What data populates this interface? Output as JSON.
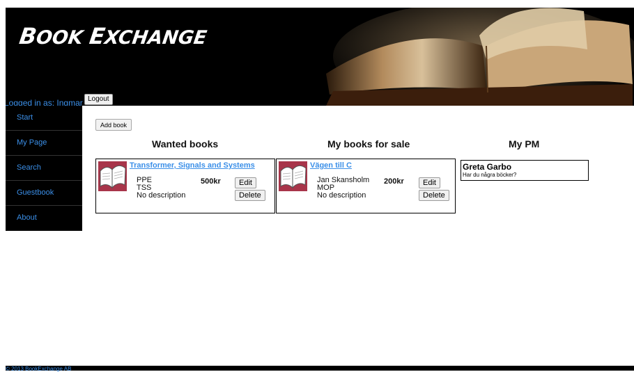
{
  "header": {
    "logo_part1_cap": "B",
    "logo_part1_rest": "OOK",
    "logo_part2_cap": "E",
    "logo_part2_rest": "XCHANGE",
    "logged_in_text": "Logged in as: Ingmar",
    "logout_label": "Logout"
  },
  "sidebar": {
    "items": [
      {
        "label": "Start"
      },
      {
        "label": "My Page"
      },
      {
        "label": "Search"
      },
      {
        "label": "Guestbook"
      },
      {
        "label": "About"
      }
    ]
  },
  "main": {
    "add_book_label": "Add book",
    "columns": {
      "wanted": "Wanted books",
      "for_sale": "My books for sale",
      "pm": "My PM"
    },
    "wanted_books": [
      {
        "title": "Transformer, Signals and Systems",
        "author": "PPE",
        "course": "TSS",
        "description": "No description",
        "price": "500kr",
        "edit_label": "Edit",
        "delete_label": "Delete"
      }
    ],
    "books_for_sale": [
      {
        "title": "Vägen till C",
        "author": "Jan Skansholm",
        "course": "MOP",
        "description": "No description",
        "price": "200kr",
        "edit_label": "Edit",
        "delete_label": "Delete"
      }
    ],
    "pm": [
      {
        "from": "Greta Garbo",
        "message": "Har du några böcker?"
      }
    ]
  },
  "footer": {
    "copyright": "© 2013 BookExchange AB"
  }
}
